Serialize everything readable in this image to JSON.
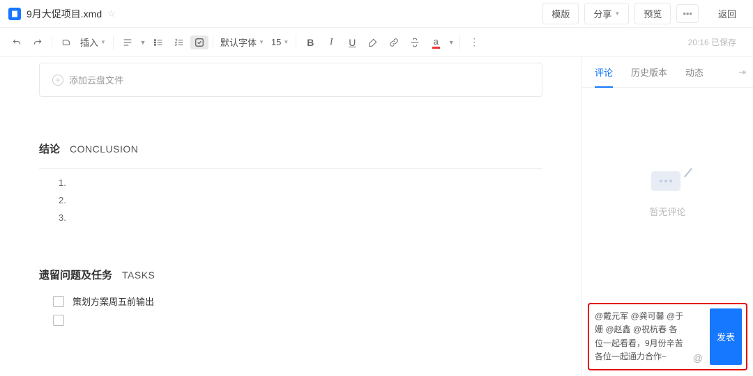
{
  "file": {
    "title": "9月大促项目.xmd"
  },
  "top_buttons": {
    "template": "模版",
    "share": "分享",
    "preview": "预览",
    "return": "返回"
  },
  "toolbar": {
    "insert": "插入",
    "font_name": "默认字体",
    "font_size": "15",
    "save_info": "20:16 已保存"
  },
  "cloud_block": {
    "label": "添加云盘文件"
  },
  "sections": {
    "conclusion": {
      "zh": "结论",
      "en": "CONCLUSION",
      "items": [
        "1.",
        "2.",
        "3."
      ]
    },
    "tasks": {
      "zh": "遗留问题及任务",
      "en": "TASKS",
      "rows": [
        {
          "label": "策划方案周五前输出"
        },
        {
          "label": ""
        }
      ]
    }
  },
  "sidebar": {
    "tabs": {
      "comments": "评论",
      "history": "历史版本",
      "activity": "动态"
    },
    "empty_text": "暂无评论"
  },
  "comment": {
    "text": "@戴元军 @龚可馨 @于姗 @赵鑫 @祝杭春 各位一起看看，9月份辛苦各位一起通力合作~",
    "at_symbol": "@",
    "submit": "发表"
  }
}
